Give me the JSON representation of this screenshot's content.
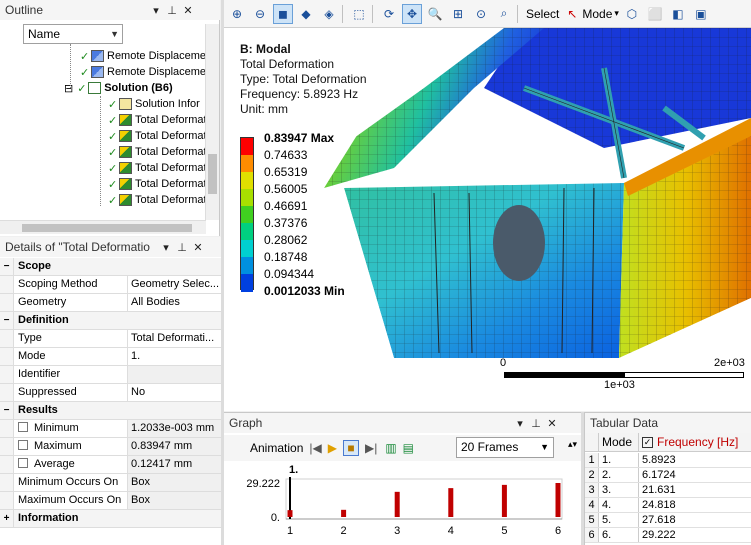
{
  "outline": {
    "title": "Outline",
    "filter_value": "Name",
    "tree": [
      {
        "label": "Remote Displaceme",
        "icon": "remote-displacement-icon"
      },
      {
        "label": "Remote Displaceme",
        "icon": "remote-displacement-icon"
      },
      {
        "label": "Solution (B6)",
        "icon": "solution-icon",
        "bold": true
      },
      {
        "label": "Solution Infor",
        "icon": "solution-information-icon"
      },
      {
        "label": "Total Deformat",
        "icon": "total-deformation-icon"
      },
      {
        "label": "Total Deformat",
        "icon": "total-deformation-icon"
      },
      {
        "label": "Total Deformat",
        "icon": "total-deformation-icon"
      },
      {
        "label": "Total Deformat",
        "icon": "total-deformation-icon"
      },
      {
        "label": "Total Deformat",
        "icon": "total-deformation-icon"
      },
      {
        "label": "Total Deformat",
        "icon": "total-deformation-icon"
      }
    ]
  },
  "details": {
    "title": "Details of \"Total Deformatio",
    "groups": [
      {
        "name": "Scope",
        "rows": [
          {
            "label": "Scoping Method",
            "value": "Geometry Selec..."
          },
          {
            "label": "Geometry",
            "value": "All Bodies"
          }
        ]
      },
      {
        "name": "Definition",
        "rows": [
          {
            "label": "Type",
            "value": "Total Deformati..."
          },
          {
            "label": "Mode",
            "value": "1."
          },
          {
            "label": "Identifier",
            "value": ""
          },
          {
            "label": "Suppressed",
            "value": "No"
          }
        ]
      },
      {
        "name": "Results",
        "rows": [
          {
            "label": "Minimum",
            "value": "1.2033e-003 mm"
          },
          {
            "label": "Maximum",
            "value": "0.83947 mm"
          },
          {
            "label": "Average",
            "value": "0.12417 mm"
          },
          {
            "label": "Minimum Occurs On",
            "value": "Box"
          },
          {
            "label": "Maximum Occurs On",
            "value": "Box"
          }
        ]
      },
      {
        "name": "Information",
        "rows": []
      }
    ]
  },
  "toolbar": {
    "select_label": "Select",
    "mode_label": "Mode"
  },
  "viewport": {
    "title": "B: Modal",
    "lines": [
      "Total Deformation",
      "Type: Total Deformation",
      "Frequency: 5.8923 Hz",
      "Unit: mm"
    ],
    "legend": [
      {
        "label": "0.83947 Max",
        "color": "#ff0000",
        "bold": true
      },
      {
        "label": "0.74633",
        "color": "#ff8c00"
      },
      {
        "label": "0.65319",
        "color": "#e0e000"
      },
      {
        "label": "0.56005",
        "color": "#a8e000"
      },
      {
        "label": "0.46691",
        "color": "#40d020"
      },
      {
        "label": "0.37376",
        "color": "#00d080"
      },
      {
        "label": "0.28062",
        "color": "#00d0d0"
      },
      {
        "label": "0.18748",
        "color": "#0090e0"
      },
      {
        "label": "0.094344",
        "color": "#0040e0"
      },
      {
        "label": "0.0012033 Min",
        "color": "#0000d0",
        "bold": true
      }
    ],
    "scale": {
      "left": "0",
      "right": "2e+03",
      "mid": "1e+03"
    }
  },
  "graph": {
    "title": "Graph",
    "animation_label": "Animation",
    "frames_value": "20 Frames",
    "chart_data": {
      "type": "bar",
      "categories": [
        "1",
        "2",
        "3",
        "4",
        "5",
        "6"
      ],
      "values": [
        5.8923,
        6.1724,
        21.631,
        24.818,
        27.618,
        29.222
      ],
      "ytick_labels": [
        "29.222",
        "0."
      ],
      "ylim": [
        0,
        29.222
      ],
      "cursor_label": "1."
    }
  },
  "tabular": {
    "title": "Tabular Data",
    "col_mode": "Mode",
    "col_freq": "Frequency [Hz]",
    "rows": [
      {
        "n": "1",
        "mode": "1.",
        "freq": "5.8923"
      },
      {
        "n": "2",
        "mode": "2.",
        "freq": "6.1724"
      },
      {
        "n": "3",
        "mode": "3.",
        "freq": "21.631"
      },
      {
        "n": "4",
        "mode": "4.",
        "freq": "24.818"
      },
      {
        "n": "5",
        "mode": "5.",
        "freq": "27.618"
      },
      {
        "n": "6",
        "mode": "6.",
        "freq": "29.222"
      }
    ]
  }
}
